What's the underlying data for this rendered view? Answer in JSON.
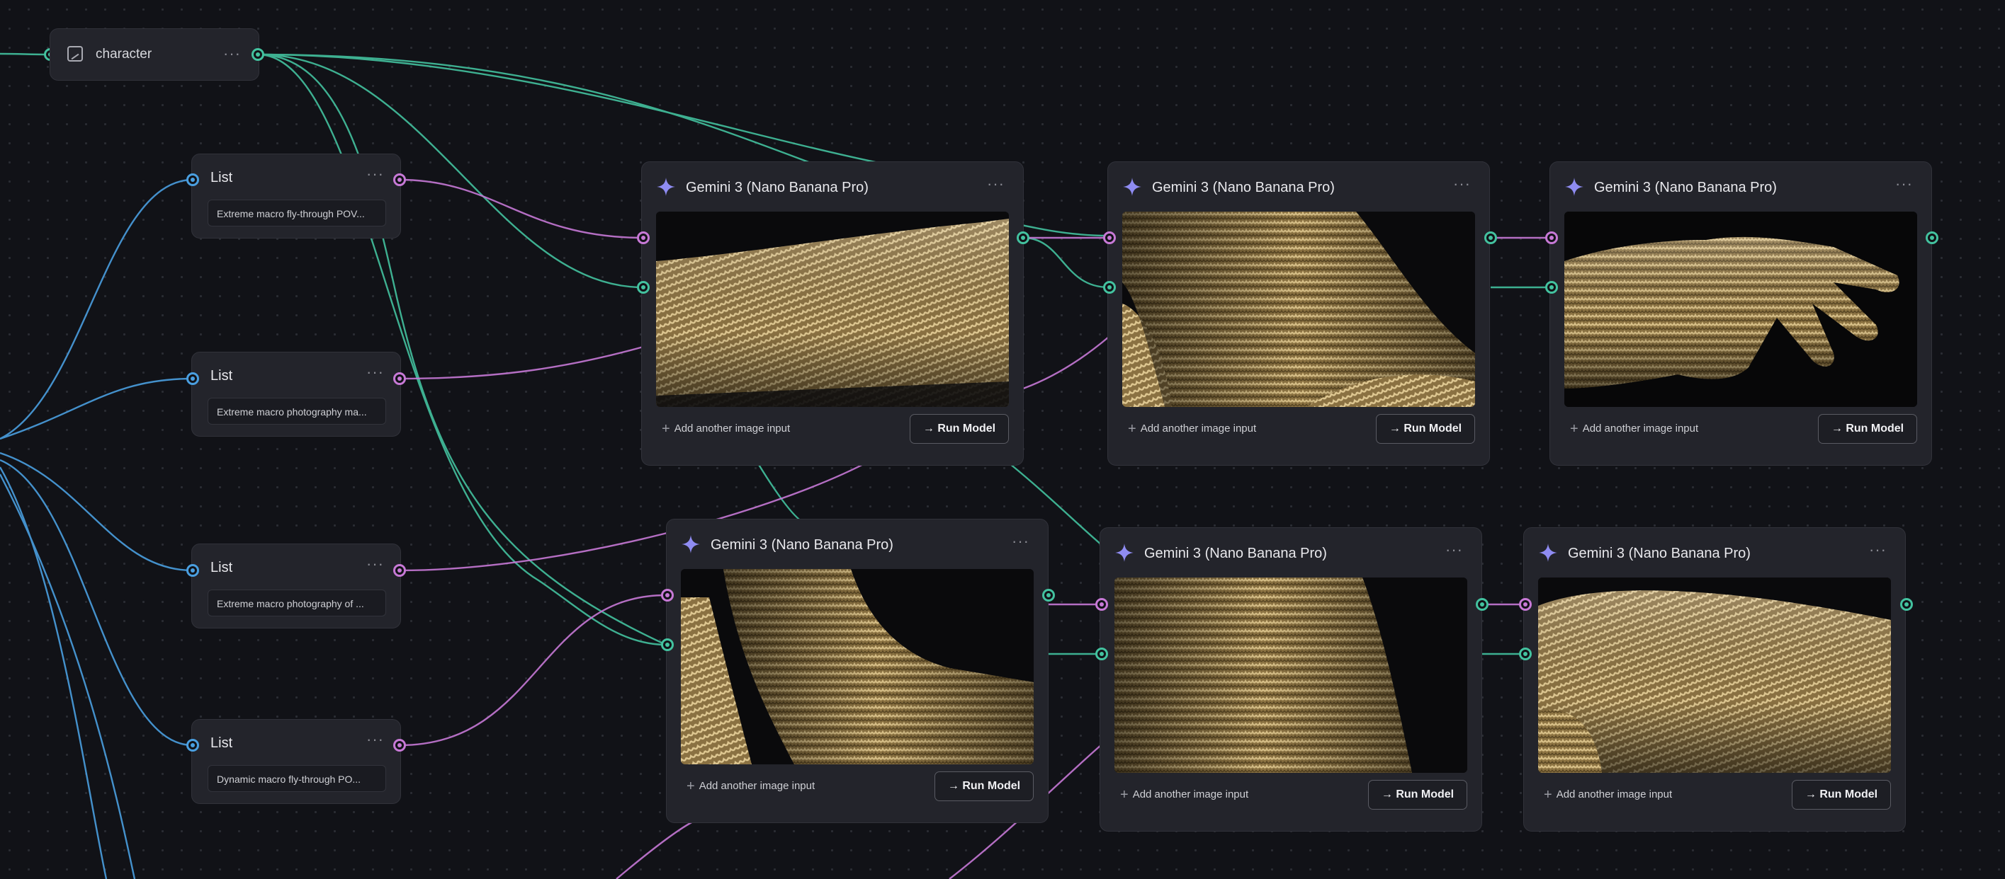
{
  "canvas": {
    "colors": {
      "background": "#111217",
      "teal": "#43c29f",
      "blue": "#4a9fe0",
      "pink": "#c779d6",
      "accent_star": "#8f8cf2"
    }
  },
  "character_node": {
    "title": "character",
    "icon": "image-icon",
    "menu": "···"
  },
  "list_nodes": [
    {
      "title": "List",
      "menu": "···",
      "value": "Extreme macro fly-through POV..."
    },
    {
      "title": "List",
      "menu": "···",
      "value": "Extreme macro photography ma..."
    },
    {
      "title": "List",
      "menu": "···",
      "value": "Extreme macro photography of ..."
    },
    {
      "title": "List",
      "menu": "···",
      "value": "Dynamic macro fly-through PO..."
    }
  ],
  "gemini_nodes": [
    {
      "title": "Gemini 3 (Nano Banana Pro)",
      "menu": "···",
      "image": "knit-sleeve-forearm",
      "add_input": "Add another image input",
      "run": "Run Model"
    },
    {
      "title": "Gemini 3 (Nano Banana Pro)",
      "menu": "···",
      "image": "knit-sleeve-elbow",
      "add_input": "Add another image input",
      "run": "Run Model"
    },
    {
      "title": "Gemini 3 (Nano Banana Pro)",
      "menu": "···",
      "image": "knit-glove-hand",
      "add_input": "Add another image input",
      "run": "Run Model"
    },
    {
      "title": "Gemini 3 (Nano Banana Pro)",
      "menu": "···",
      "image": "knit-sleeve-bent-arm",
      "add_input": "Add another image input",
      "run": "Run Model"
    },
    {
      "title": "Gemini 3 (Nano Banana Pro)",
      "menu": "···",
      "image": "knit-texture-closeup",
      "add_input": "Add another image input",
      "run": "Run Model"
    },
    {
      "title": "Gemini 3 (Nano Banana Pro)",
      "menu": "···",
      "image": "knit-sleeve-cuff",
      "add_input": "Add another image input",
      "run": "Run Model"
    }
  ],
  "icons": {
    "run_arrow": "→",
    "add": "+",
    "star": "sparkle-icon"
  }
}
